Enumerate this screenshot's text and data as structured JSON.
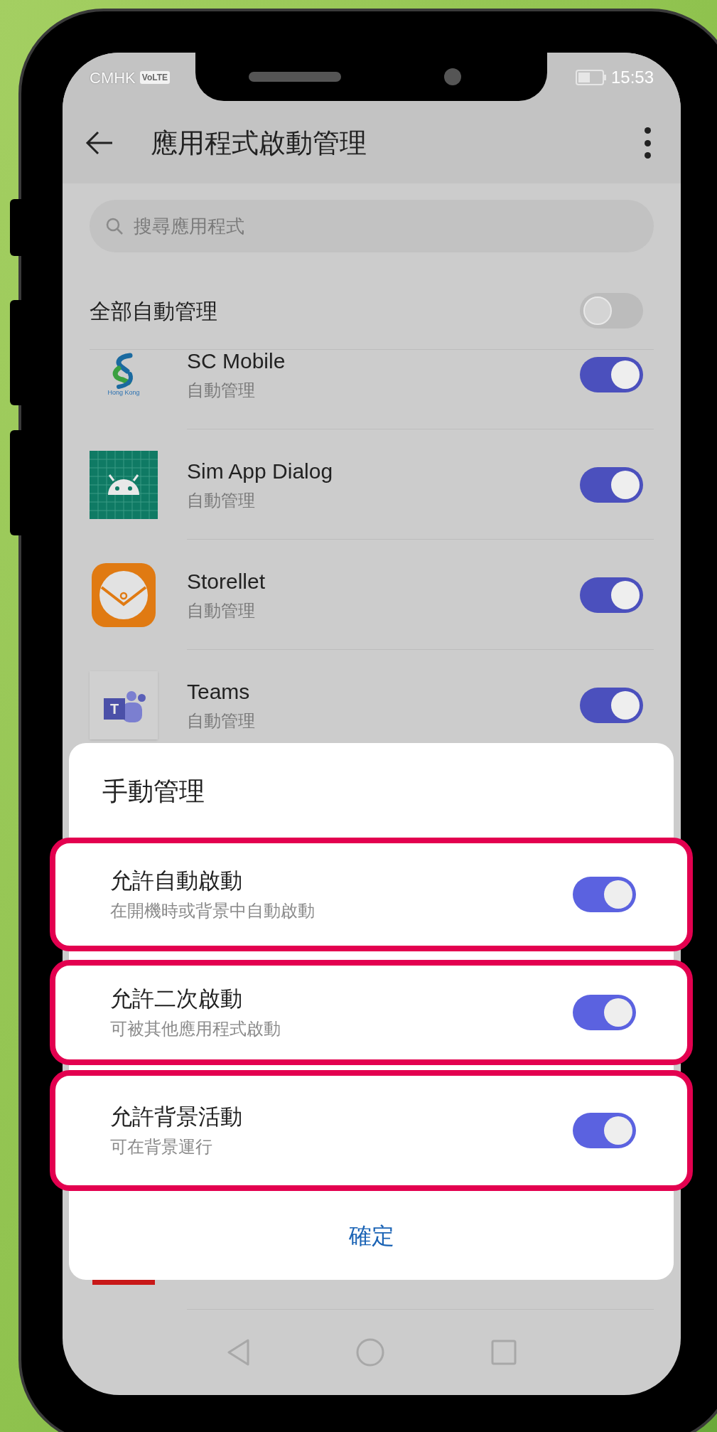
{
  "status_bar": {
    "carrier": "CMHK",
    "network_badge": "VoLTE",
    "time": "15:53"
  },
  "app_bar": {
    "title": "應用程式啟動管理"
  },
  "search": {
    "placeholder": "搜尋應用程式"
  },
  "manage_all": {
    "label": "全部自動管理",
    "on": false
  },
  "apps": [
    {
      "name": "SC Mobile",
      "status": "自動管理",
      "on": true,
      "kind": "sc",
      "icon_text": "Hong Kong"
    },
    {
      "name": "Sim App Dialog",
      "status": "自動管理",
      "on": true,
      "kind": "grid"
    },
    {
      "name": "Storellet",
      "status": "自動管理",
      "on": true,
      "kind": "wallet"
    },
    {
      "name": "Teams",
      "status": "自動管理",
      "on": true,
      "kind": "teams",
      "icon_text": "T"
    }
  ],
  "dialog": {
    "title": "手動管理",
    "options": [
      {
        "title": "允許自動啟動",
        "subtitle": "在開機時或背景中自動啟動",
        "on": true,
        "highlighted": true
      },
      {
        "title": "允許二次啟動",
        "subtitle": "可被其他應用程式啟動",
        "on": true,
        "highlighted": true
      },
      {
        "title": "允許背景活動",
        "subtitle": "可在背景運行",
        "on": true,
        "highlighted": true
      }
    ],
    "confirm": "確定"
  }
}
